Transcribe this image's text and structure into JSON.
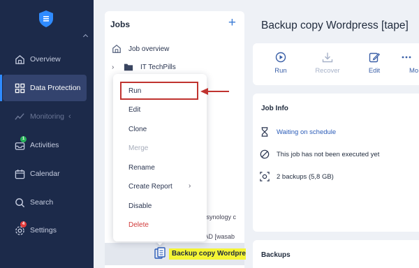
{
  "sidebar": {
    "items": [
      {
        "label": "Overview",
        "icon": "home-icon"
      },
      {
        "label": "Data Protection",
        "icon": "grid-icon",
        "active": true
      },
      {
        "label": "Monitoring",
        "icon": "pulse-icon",
        "dim": true
      },
      {
        "label": "Activities",
        "icon": "inbox-icon",
        "badge": "1"
      },
      {
        "label": "Calendar",
        "icon": "calendar-icon"
      },
      {
        "label": "Search",
        "icon": "search-icon"
      },
      {
        "label": "Settings",
        "icon": "gear-icon",
        "badge": "4"
      }
    ]
  },
  "jobs": {
    "title": "Jobs",
    "add": "+",
    "overview_label": "Job overview",
    "folder_label": "IT TechPills",
    "ghost_1": "y [synology c",
    "ghost_2": "y AD [wasab",
    "selected_job": "Backup copy Wordpress [tape]"
  },
  "context_menu": {
    "items": [
      "Run",
      "Edit",
      "Clone",
      "Merge",
      "Rename",
      "Create Report",
      "Disable",
      "Delete"
    ]
  },
  "main": {
    "title": "Backup copy Wordpress [tape]",
    "toolbar": {
      "run": "Run",
      "recover": "Recover",
      "edit": "Edit",
      "more": "Mo"
    },
    "job_info": {
      "title": "Job Info",
      "status": "Waiting on schedule",
      "last_run": "This job has not been executed yet",
      "backups": "2 backups (5,8 GB)"
    },
    "backups_title": "Backups"
  },
  "colors": {
    "sidebar_bg": "#1c2a4a",
    "active_nav": "#33436e",
    "accent": "#2f8bff",
    "highlight": "#f5f535",
    "annotation": "#c0332f"
  }
}
